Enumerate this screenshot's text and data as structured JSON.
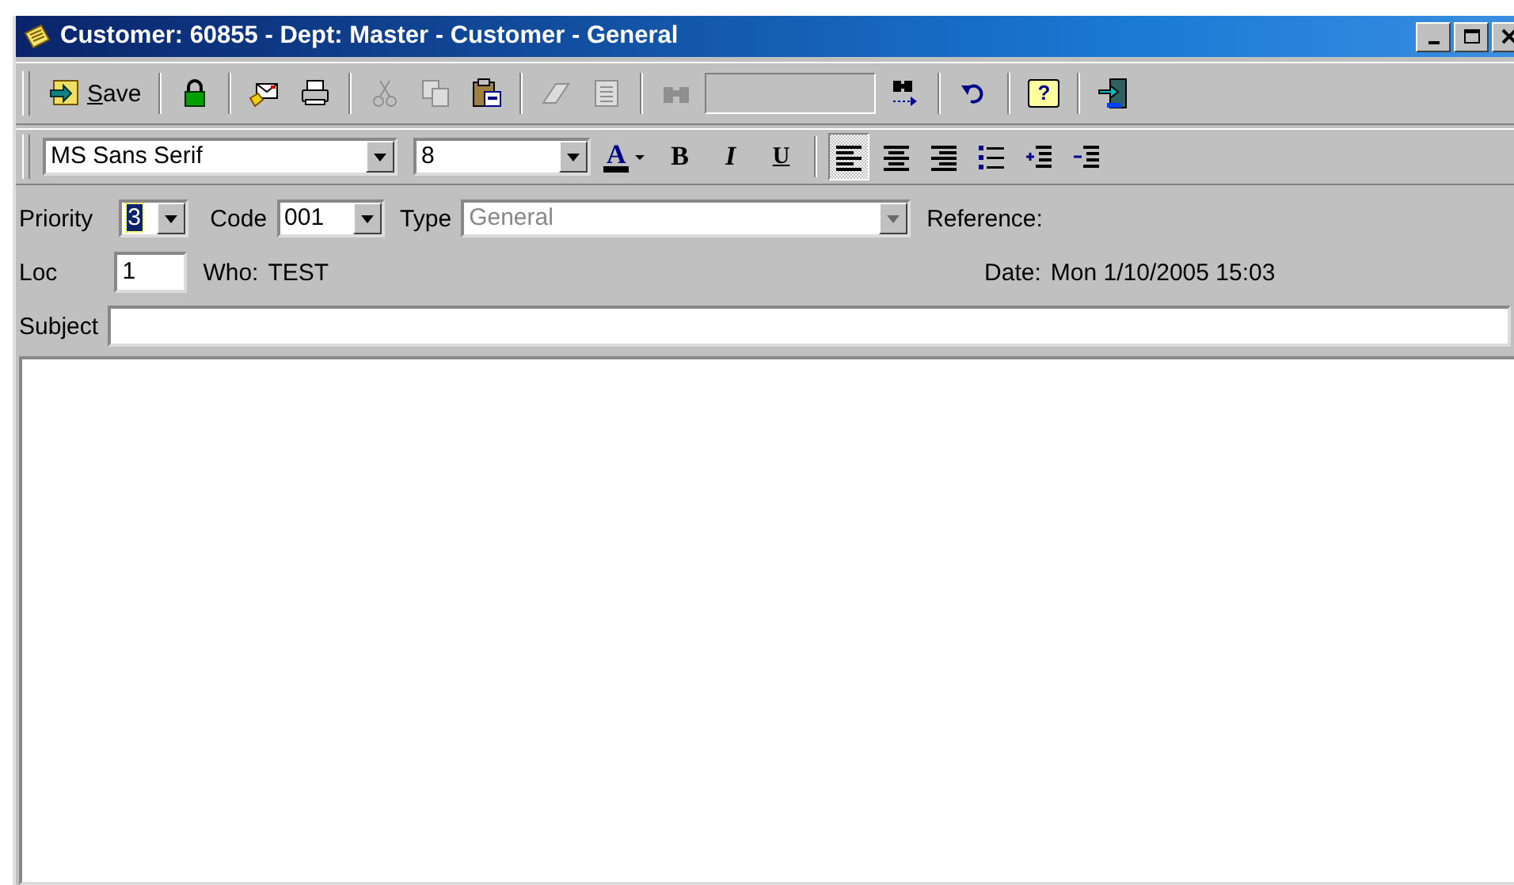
{
  "window": {
    "title": "Customer: 60855 - Dept: Master - Customer - General"
  },
  "toolbar": [
    {
      "label": "Save",
      "disabled": false
    },
    {
      "disabled": false
    },
    {
      "disabled": false
    },
    {
      "disabled": false
    },
    {
      "disabled": true
    },
    {
      "disabled": true
    },
    {
      "disabled": false
    },
    {
      "disabled": true
    },
    {
      "disabled": true
    },
    {
      "disabled": true
    },
    {
      "kind": "field",
      "disabled": true
    },
    {
      "disabled": false
    },
    {
      "disabled": false
    },
    {
      "glyph": "?",
      "disabled": false
    },
    {
      "disabled": false
    }
  ],
  "format_bar": {
    "font_name": "MS Sans Serif",
    "font_size": "8",
    "font_color": "A",
    "bold": "B",
    "italic": "I",
    "underline": "U",
    "align": [
      {
        "selected": true
      },
      {
        "selected": false
      },
      {
        "selected": false
      }
    ]
  },
  "form": {
    "priority_label": "Priority",
    "priority": "3",
    "code_label": "Code",
    "code": "001",
    "type_label": "Type",
    "type": "General",
    "type_disabled": true,
    "reference_label": "Reference:",
    "loc_label": "Loc",
    "loc": "1",
    "who_label": "Who:",
    "who": "TEST",
    "date_label": "Date:",
    "date": "Mon 1/10/2005 15:03",
    "subject_label": "Subject"
  }
}
